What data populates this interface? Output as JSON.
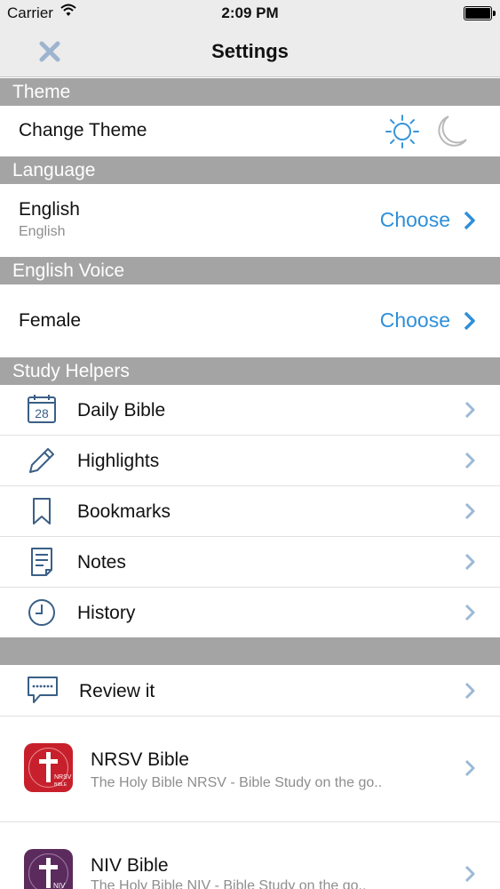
{
  "status_bar": {
    "carrier": "Carrier",
    "time": "2:09 PM"
  },
  "nav": {
    "title": "Settings",
    "close_icon": "close-icon"
  },
  "theme": {
    "header": "Theme",
    "change_label": "Change Theme",
    "sun_icon": "sun-icon",
    "moon_icon": "moon-icon"
  },
  "language": {
    "header": "Language",
    "value": "English",
    "sub": "English",
    "choose": "Choose"
  },
  "voice": {
    "header": "English Voice",
    "value": "Female",
    "choose": "Choose"
  },
  "study_helpers": {
    "header": "Study Helpers",
    "items": [
      {
        "label": "Daily Bible",
        "icon": "calendar-icon",
        "calendar_day": "28"
      },
      {
        "label": "Highlights",
        "icon": "pencil-icon"
      },
      {
        "label": "Bookmarks",
        "icon": "bookmark-icon"
      },
      {
        "label": "Notes",
        "icon": "notes-icon"
      },
      {
        "label": "History",
        "icon": "clock-icon"
      }
    ]
  },
  "more": {
    "review_label": "Review it",
    "review_icon": "chat-bubble-icon",
    "apps": [
      {
        "title": "NRSV Bible",
        "subtitle": "The Holy Bible NRSV - Bible Study on the go..",
        "icon_text": "NRSV BIBLE",
        "icon_color": "#c7202c"
      },
      {
        "title": "NIV Bible",
        "subtitle": "The Holy Bible NIV - Bible Study on the go..",
        "icon_text": "NIV",
        "icon_color": "#5b2b5e"
      }
    ]
  },
  "colors": {
    "accent": "#2f8fd8",
    "section_header": "#a4a4a4",
    "chevron": "#9bb9d6"
  }
}
